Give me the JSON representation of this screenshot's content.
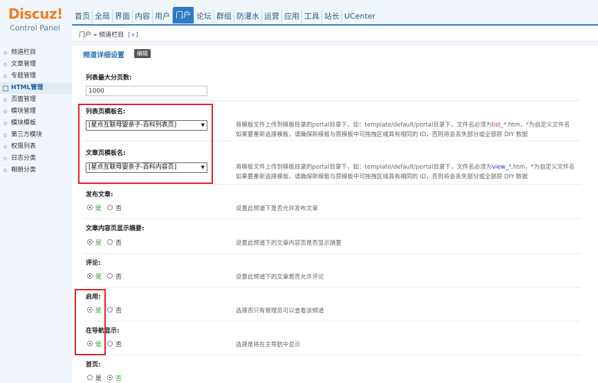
{
  "logo": {
    "brand": "Discuz!",
    "subtitle": "Control Panel"
  },
  "topnav": [
    "首页",
    "全局",
    "界面",
    "内容",
    "用户",
    "门户",
    "论坛",
    "群组",
    "防灌水",
    "运营",
    "应用",
    "工具",
    "站长",
    "UCenter"
  ],
  "topnav_active": "门户",
  "breadcrumb": {
    "path": "门户 » 频道栏目",
    "add": "[+]"
  },
  "sidebar": [
    "频道栏目",
    "文章管理",
    "专题管理",
    "HTML管理",
    "页面管理",
    "模块管理",
    "模块模板",
    "第三方模块",
    "权限列表",
    "日志分类",
    "相册分类"
  ],
  "sidebar_active": "HTML管理",
  "main": {
    "section_title": "频道详细设置",
    "edit_label": "编辑",
    "max_pages_label": "列表最大分页数:",
    "max_pages_value": "1000",
    "list_tpl_label": "列表页模板名:",
    "list_tpl_value": "[星点互联母婴亲子-百科列表页]",
    "list_tip_line1_a": "将模板文件上传到模板目录的portal目录下，如：template/default/portal目录下，文件名必须为",
    "list_tip_line1_b": "list_",
    "list_tip_line1_c": "*.htm，*为自定义文件名",
    "list_tip_line2": "如果要重新选择模板，请确保新模板与原模板中可拖拽区域具有相同的 ID，否则将会丢失部分或全部原 DIY 数据",
    "article_tpl_label": "文章页模板名:",
    "article_tpl_value": "[星点互联母婴亲子-百科内容页]",
    "article_tip_line1_a": "将模板文件上传到模板目录的portal目录下，如：template/default/portal目录下，文件名必须为",
    "article_tip_line1_b": "view_",
    "article_tip_line1_c": "*.htm，*为自定义文件名",
    "article_tip_line2": "如果要重新选择模板，请确保新模板与原模板中可拖拽区域具有相同的 ID，否则将会丢失部分或全部原 DIY 数据",
    "yes": "是",
    "no": "否",
    "settings": [
      {
        "label": "发布文章:",
        "value": "是",
        "tip": "设置此频道下是否允许发布文章"
      },
      {
        "label": "文章内容页显示摘要:",
        "value": "是",
        "tip": "设置此频道下的文章内容页是否显示摘要"
      },
      {
        "label": "评论:",
        "value": "是",
        "tip": "设置此频道下的文章是否允许评论"
      },
      {
        "label": "启用:",
        "value": "是",
        "tip": "选择否只有管理员可以查看该频道"
      },
      {
        "label": "在导航显示:",
        "value": "是",
        "tip": "选择是将在主导航中显示"
      },
      {
        "label": "首页:",
        "value": "否",
        "tip": ""
      }
    ]
  },
  "colors": {
    "accent": "#2e7bc4",
    "highlight_box": "#e02020",
    "yes_green": "#2ea02e"
  }
}
